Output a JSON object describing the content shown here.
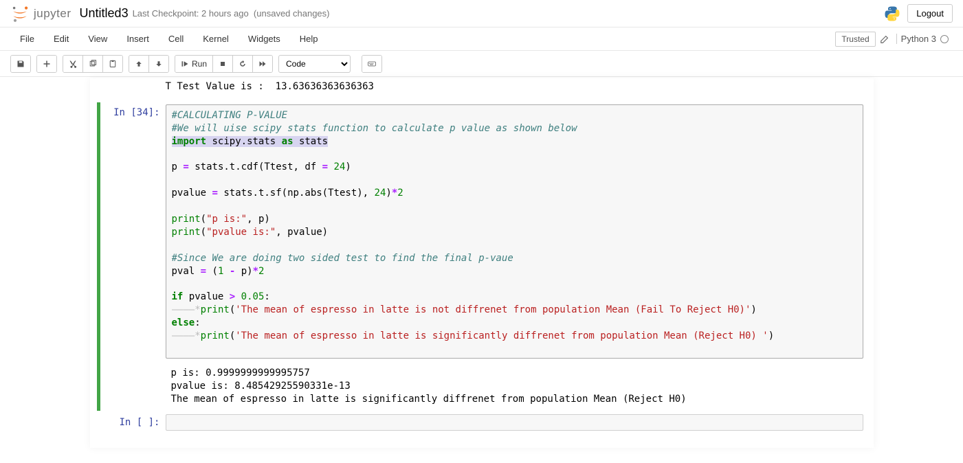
{
  "header": {
    "logo_text": "jupyter",
    "title": "Untitled3",
    "checkpoint": "Last Checkpoint: 2 hours ago",
    "unsaved": "(unsaved changes)",
    "logout": "Logout"
  },
  "menu": {
    "file": "File",
    "edit": "Edit",
    "view": "View",
    "insert": "Insert",
    "cell": "Cell",
    "kernel": "Kernel",
    "widgets": "Widgets",
    "help": "Help",
    "trusted": "Trusted",
    "kernel_name": "Python 3"
  },
  "toolbar": {
    "run": "Run",
    "cell_type": "Code"
  },
  "cells": {
    "prev_output": "T Test Value is :  13.63636363636363",
    "cell1": {
      "prompt": "In [34]:",
      "code": {
        "l1": "#CALCULATING P-VALUE",
        "l2": "#We will uise scipy stats function to calculate p value as shown below",
        "l3a": "import",
        "l3b": " scipy.stats ",
        "l3c": "as",
        "l3d": " stats",
        "l5a": "p ",
        "l5b": "=",
        "l5c": " stats.t.cdf(Ttest, df ",
        "l5d": "=",
        "l5e": " ",
        "l5f": "24",
        "l5g": ")",
        "l7a": "pvalue ",
        "l7b": "=",
        "l7c": " stats.t.sf(np.abs(Ttest), ",
        "l7d": "24",
        "l7e": ")",
        "l7f": "*",
        "l7g": "2",
        "l9a": "print",
        "l9b": "(",
        "l9c": "\"p is:\"",
        "l9d": ", p)",
        "l10a": "print",
        "l10b": "(",
        "l10c": "\"pvalue is:\"",
        "l10d": ", pvalue)",
        "l12": "#Since We are doing two sided test to find the final p-vaue",
        "l13a": "pval ",
        "l13b": "=",
        "l13c": " (",
        "l13d": "1",
        "l13e": " ",
        "l13f": "-",
        "l13g": " p)",
        "l13h": "*",
        "l13i": "2",
        "l15a": "if",
        "l15b": " pvalue ",
        "l15c": ">",
        "l15d": " ",
        "l15e": "0.05",
        "l15f": ":",
        "l16a": "print",
        "l16b": "(",
        "l16c": "'The mean of espresso in latte is not diffrenet from population Mean (Fail To Reject H0)'",
        "l16d": ")",
        "l17a": "else",
        "l17b": ":",
        "l18a": "print",
        "l18b": "(",
        "l18c": "'The mean of espresso in latte is significantly diffrenet from population Mean (Reject H0) '",
        "l18d": ")"
      },
      "output": "p is: 0.9999999999995757\npvalue is: 8.48542925590331e-13\nThe mean of espresso in latte is significantly diffrenet from population Mean (Reject H0)"
    },
    "cell2": {
      "prompt": "In [ ]:"
    }
  }
}
